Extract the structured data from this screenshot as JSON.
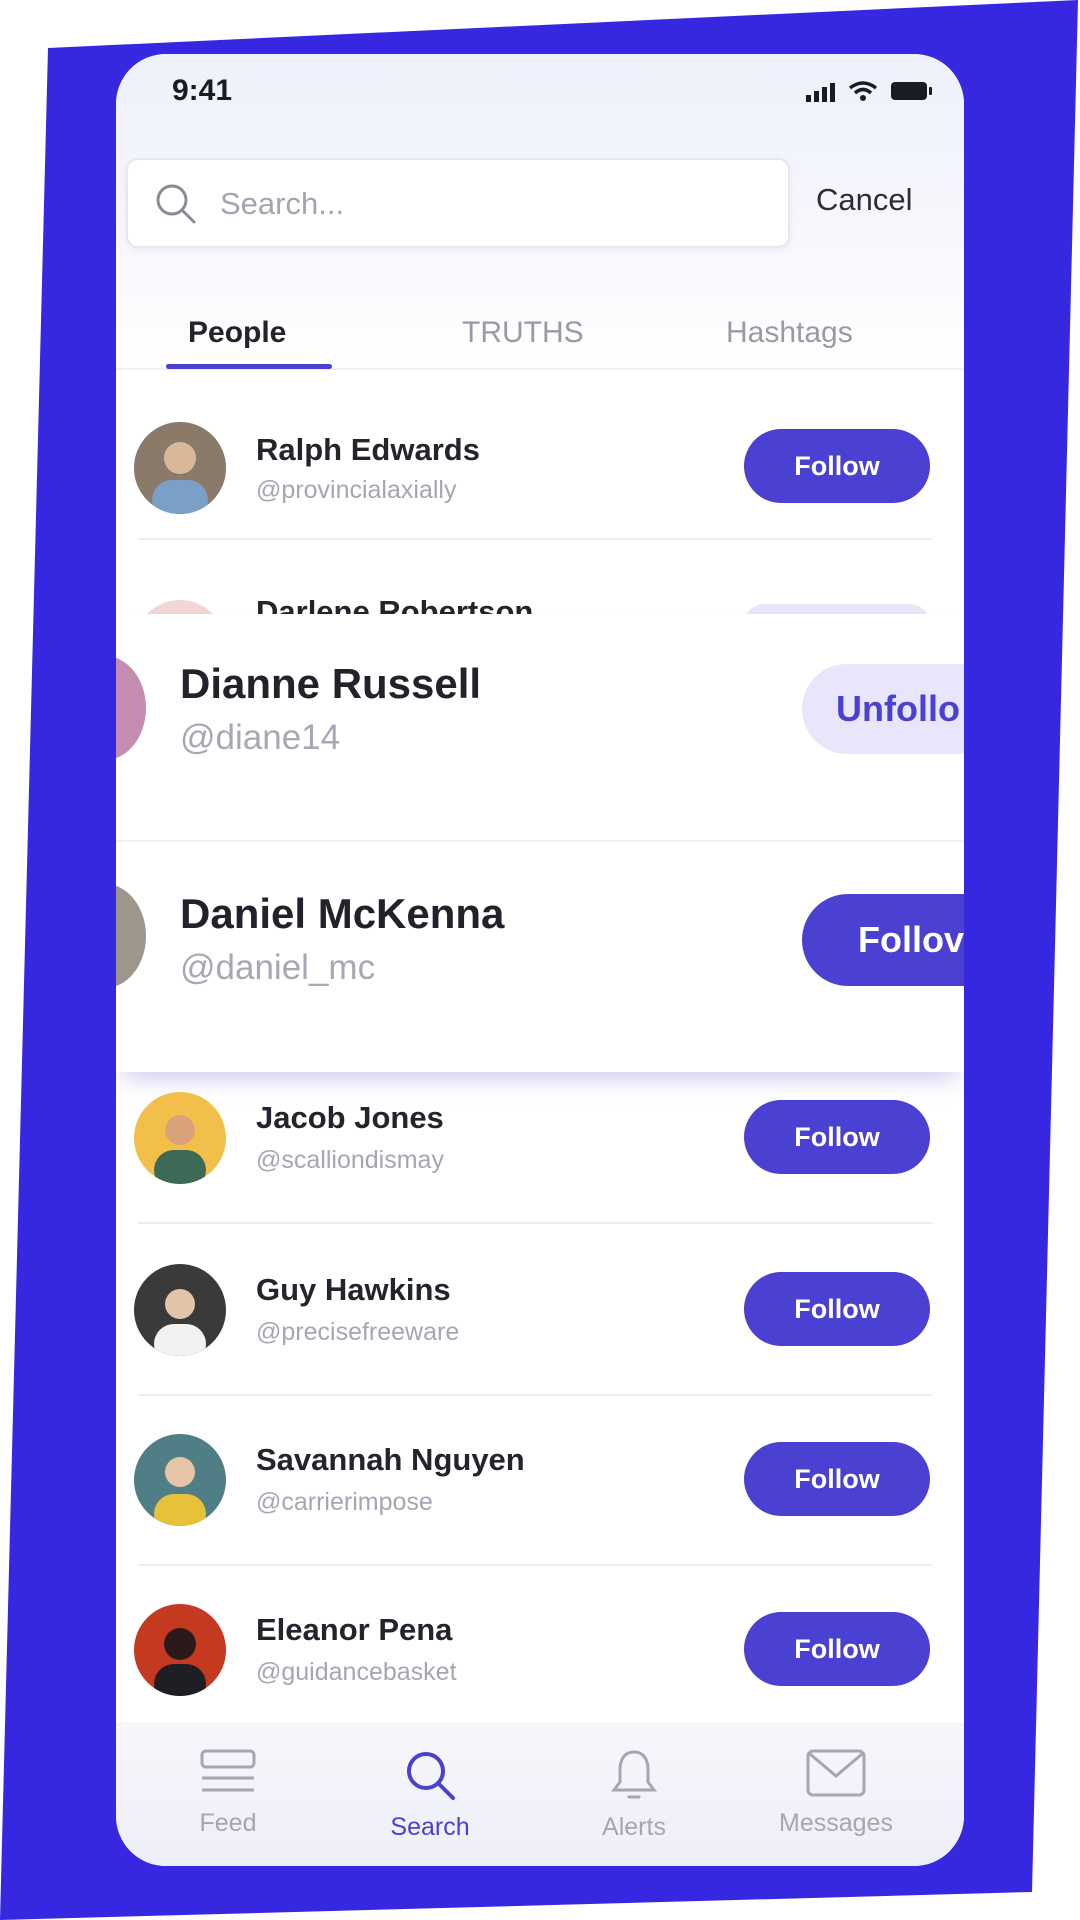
{
  "status_bar": {
    "time": "9:41"
  },
  "search": {
    "placeholder": "Search...",
    "cancel_label": "Cancel"
  },
  "tabs": [
    {
      "label": "People",
      "active": true
    },
    {
      "label": "TRUTHS",
      "active": false
    },
    {
      "label": "Hashtags",
      "active": false
    }
  ],
  "people": [
    {
      "name": "Ralph Edwards",
      "handle": "@provincialaxially",
      "button": "Follow"
    },
    {
      "name": "Darlene Robertson",
      "handle": "",
      "button": ""
    },
    {
      "name": "Jacob Jones",
      "handle": "@scalliondismay",
      "button": "Follow"
    },
    {
      "name": "Guy Hawkins",
      "handle": "@precisefreeware",
      "button": "Follow"
    },
    {
      "name": "Savannah Nguyen",
      "handle": "@carrierimpose",
      "button": "Follow"
    },
    {
      "name": "Eleanor Pena",
      "handle": "@guidancebasket",
      "button": "Follow"
    }
  ],
  "featured": [
    {
      "name": "Dianne Russell",
      "handle": "@diane14",
      "button": "Unfollo"
    },
    {
      "name": "Daniel McKenna",
      "handle": "@daniel_mc",
      "button": "Follov"
    }
  ],
  "bottom_nav": [
    {
      "label": "Feed",
      "icon": "feed-icon"
    },
    {
      "label": "Search",
      "icon": "search-icon"
    },
    {
      "label": "Alerts",
      "icon": "bell-icon"
    },
    {
      "label": "Messages",
      "icon": "mail-icon"
    }
  ],
  "colors": {
    "accent": "#4a40d1",
    "background": "#3628e0"
  }
}
